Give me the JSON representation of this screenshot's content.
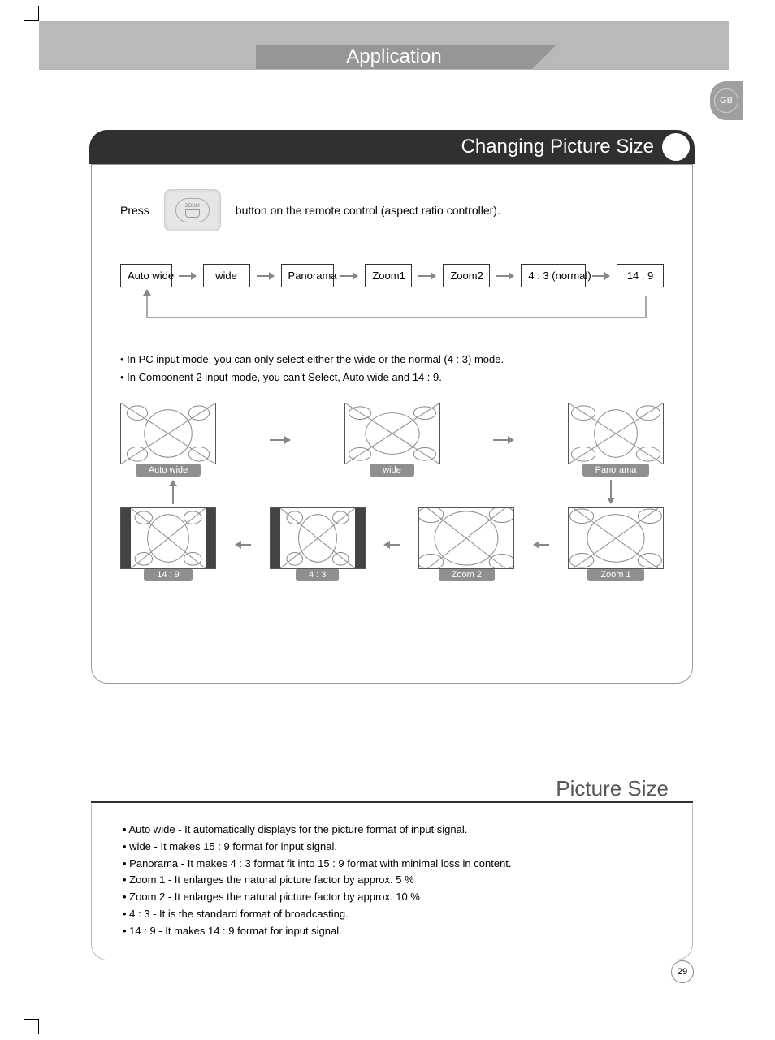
{
  "header": {
    "title": "Application",
    "lang_tab": "GB"
  },
  "section_main": {
    "heading": "Changing Picture Size",
    "instruction_pre": "Press",
    "zoom_button_label": "ZOOM",
    "instruction_post": "button on the remote control (aspect ratio controller).",
    "flow": [
      "Auto wide",
      "wide",
      "Panorama",
      "Zoom1",
      "Zoom2",
      "4 : 3 (normal)",
      "14 : 9"
    ],
    "notes": [
      "In PC input mode, you can only select either the wide or the normal (4 : 3) mode.",
      "In Component 2 input mode, you can't Select,  Auto wide and 14 : 9."
    ],
    "tiles_top": [
      "Auto wide",
      "wide",
      "Panorama"
    ],
    "tiles_bottom": [
      "14 : 9",
      "4 : 3",
      "Zoom 2",
      "Zoom 1"
    ]
  },
  "section_picture_size": {
    "heading": "Picture Size",
    "items": [
      "Auto wide - It automatically displays for the picture format of input signal.",
      "wide - It makes 15 : 9 format for input signal.",
      "Panorama - It makes 4 : 3 format fit into 15 : 9 format with minimal loss in content.",
      "Zoom 1 - It enlarges the natural picture factor by approx. 5 %",
      "Zoom 2 - It enlarges the natural picture factor by approx. 10 %",
      "4 : 3 - It is the standard format of broadcasting.",
      "14 : 9 - It makes 14 : 9 format for input signal."
    ]
  },
  "page_number": "29"
}
